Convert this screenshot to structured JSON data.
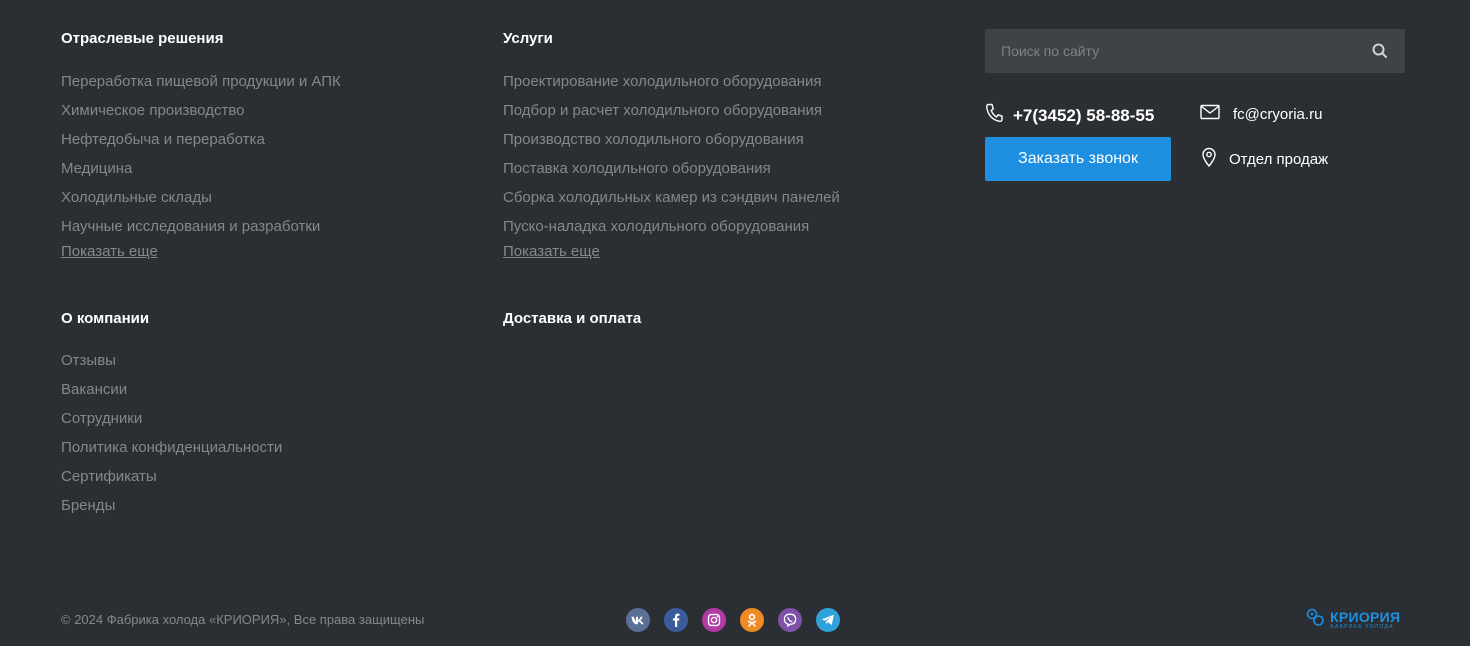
{
  "industry": {
    "title": "Отраслевые решения",
    "items": [
      "Переработка пищевой продукции и АПК",
      "Химическое производство",
      "Нефтедобыча и переработка",
      "Медицина",
      "Холодильные склады",
      "Научные исследования и разработки"
    ],
    "more": "Показать еще"
  },
  "services": {
    "title": "Услуги",
    "items": [
      "Проектирование холодильного оборудования",
      "Подбор и расчет холодильного оборудования",
      "Производство холодильного оборудования",
      "Поставка холодильного оборудования",
      "Сборка холодильных камер из сэндвич панелей",
      "Пуско-наладка холодильного оборудования"
    ],
    "more": "Показать еще"
  },
  "company": {
    "title": "О компании",
    "items": [
      "Отзывы",
      "Вакансии",
      "Сотрудники",
      "Политика конфиденциальности",
      "Сертификаты",
      "Бренды"
    ]
  },
  "delivery": {
    "title": "Доставка и оплата"
  },
  "search": {
    "placeholder": "Поиск по сайту"
  },
  "contacts": {
    "phone": "+7(3452) 58-88-55",
    "email": "fc@cryoria.ru",
    "sales": "Отдел продаж",
    "call_button": "Заказать звонок"
  },
  "footer": {
    "copyright": "© 2024 Фабрика холода «КРИОРИЯ», Все права защищены",
    "socials": [
      {
        "name": "vk-icon",
        "color": "#5a7096"
      },
      {
        "name": "facebook-icon",
        "color": "#3b5a9a"
      },
      {
        "name": "instagram-icon",
        "color": "#b13aa5"
      },
      {
        "name": "odnoklassniki-icon",
        "color": "#f08a24"
      },
      {
        "name": "viber-icon",
        "color": "#7d52a8"
      },
      {
        "name": "telegram-icon",
        "color": "#2fa3d9"
      }
    ],
    "logo_name": "КРИОРИЯ",
    "logo_tag": "ФАБРИКА ХОЛОДА"
  },
  "colors": {
    "accent": "#1e8fe0",
    "background": "#2b2f33",
    "muted_text": "#83888d"
  }
}
